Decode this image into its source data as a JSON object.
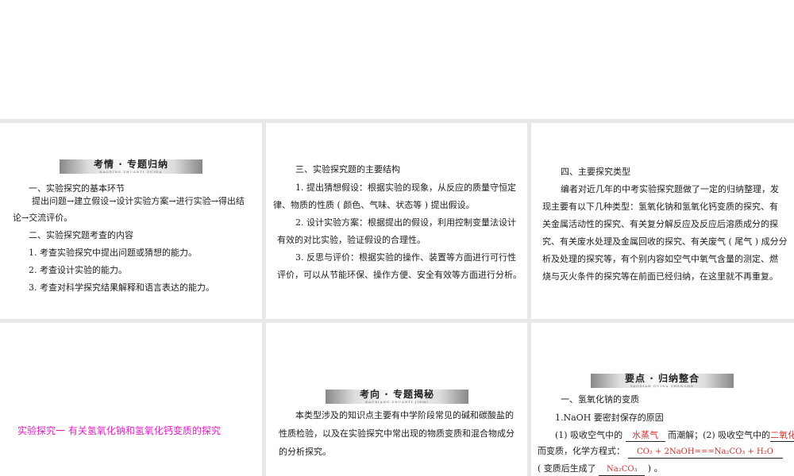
{
  "panel1": {
    "banner": {
      "title": "考情 · 专题归纳",
      "sub": "KAODING    ZHUANTI GUINA"
    },
    "h1": "一、实验探究的基本环节",
    "p1a": "提出问题→建立假设→设计实验方案→进行实验→得出结",
    "p1b": "论→交流评价。",
    "h2": "二、实验探究题考查的内容",
    "items": [
      "1. 考查实验探究中提出问题或猜想的能力。",
      "2. 考查设计实验的能力。",
      "3. 考查对科学探究结果解释和语言表达的能力。"
    ]
  },
  "panel2": {
    "h": "三、实验探究题的主要结构",
    "lines": [
      "1. 提出猜想假设：根据实验的现象，从反应的质量守恒定",
      "律、物质的性质 ( 颜色、气味、状态等 ) 提出假设。",
      "2. 设计实验方案：根据提出的假设，利用控制变量法设计",
      "有效的对比实验，验证假设的合理性。",
      "3. 反思与评价：根据实验的操作、装置等方面进行可行性",
      "评价，可以从节能环保、操作方便、安全有效等方面进行分析。"
    ]
  },
  "panel3": {
    "h": "四、主要探究类型",
    "lines": [
      "编者对近几年的中考实验探究题做了一定的归纳整理，发",
      "现主要有以下几种类型：氢氧化钠和氢氧化钙变质的探究、有",
      "关金属活动性的探究、有关复分解反应及反应后溶质成分的探",
      "究、有关废水处理及金属回收的探究、有关废气 ( 尾气 ) 成分分",
      "析及处理的探究等，有个别内容如空气中氧气含量的测定、燃",
      "烧与灭火条件的探究等在前面已经归纳，在这里就不再重复。"
    ]
  },
  "panel4": {
    "title": "实验探究一  有关氢氧化钠和氢氧化钙变质的探究"
  },
  "panel5": {
    "banner": {
      "title": "考向 · 专题揭秘",
      "sub": "KAOXIANG    ZHUANTI JIEMI"
    },
    "lines": [
      "本类型涉及的知识点主要有中学阶段常见的碱和碳酸盐的",
      "性质检验，以及在实验探究中常出现的物质变质和混合物成分",
      "的分析探究。"
    ]
  },
  "panel6": {
    "banner": {
      "title": "要点 · 归纳整合",
      "sub": "YAODIAN    GUINA ZHENGHE"
    },
    "h": "一、氢氧化钠的变质",
    "l1": "1.NaOH  要密封保存的原因",
    "l2a": "(1) 吸收空气中的",
    "a1": "水蒸气",
    "l2b": "而潮解；(2) 吸收空气中的",
    "a2": "二氧化碳",
    "l3a": "而变质，化学方程式：",
    "a3": "CO₂ + 2NaOH===Na₂CO₃ + H₂O",
    "l4a": "( 变质后生成了",
    "a4": "Na₂CO₃",
    "l4b": ") 。"
  }
}
